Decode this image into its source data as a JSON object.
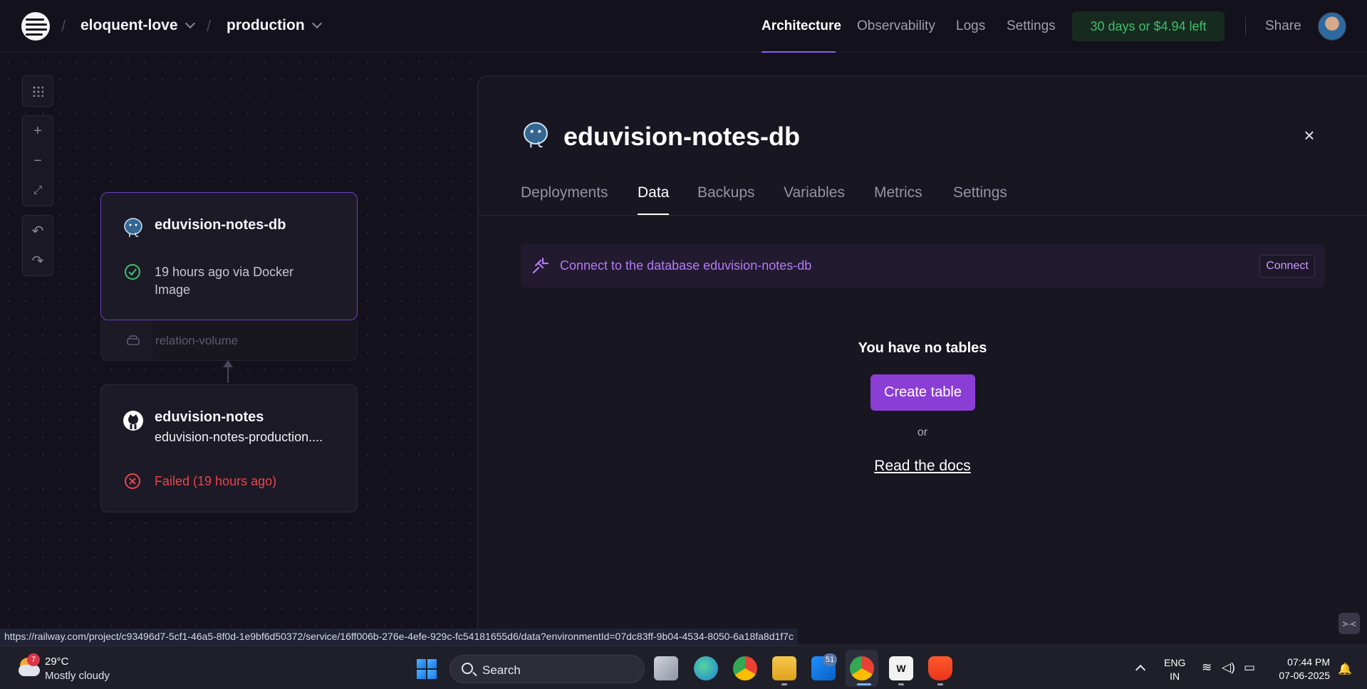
{
  "header": {
    "project": "eloquent-love",
    "environment": "production",
    "nav": [
      "Architecture",
      "Observability",
      "Logs",
      "Settings"
    ],
    "trial": "30 days or $4.94 left",
    "share": "Share"
  },
  "canvas": {
    "db_service": {
      "name": "eduvision-notes-db",
      "status_line1": "19 hours ago via Docker",
      "status_line2": "Image",
      "volume": "relation-volume"
    },
    "app_service": {
      "name": "eduvision-notes",
      "domain": "eduvision-notes-production....",
      "status": "Failed (19 hours ago)"
    }
  },
  "panel": {
    "title": "eduvision-notes-db",
    "tabs": [
      "Deployments",
      "Data",
      "Backups",
      "Variables",
      "Metrics",
      "Settings"
    ],
    "connect_text": "Connect to the database eduvision-notes-db",
    "connect_button": "Connect",
    "empty_title": "You have no tables",
    "create_button": "Create table",
    "or": "or",
    "docs_link": "Read the docs"
  },
  "status_url": "https://railway.com/project/c93496d7-5cf1-46a5-8f0d-1e9bf6d50372/service/16ff006b-276e-4efe-929c-fc54181655d6/data?environmentId=07dc83ff-9b04-4534-8050-6a18fa8d1f7c",
  "taskbar": {
    "weather_badge": "7",
    "temperature": "29°C",
    "weather": "Mostly cloudy",
    "search": "Search",
    "outlook_badge": "51",
    "lang1": "ENG",
    "lang2": "IN",
    "time": "07:44 PM",
    "date": "07-06-2025"
  },
  "colors": {
    "accent": "#8b5cf6",
    "create_button": "#8b3ed6",
    "success": "#3fbf6d",
    "error": "#e5484d"
  }
}
